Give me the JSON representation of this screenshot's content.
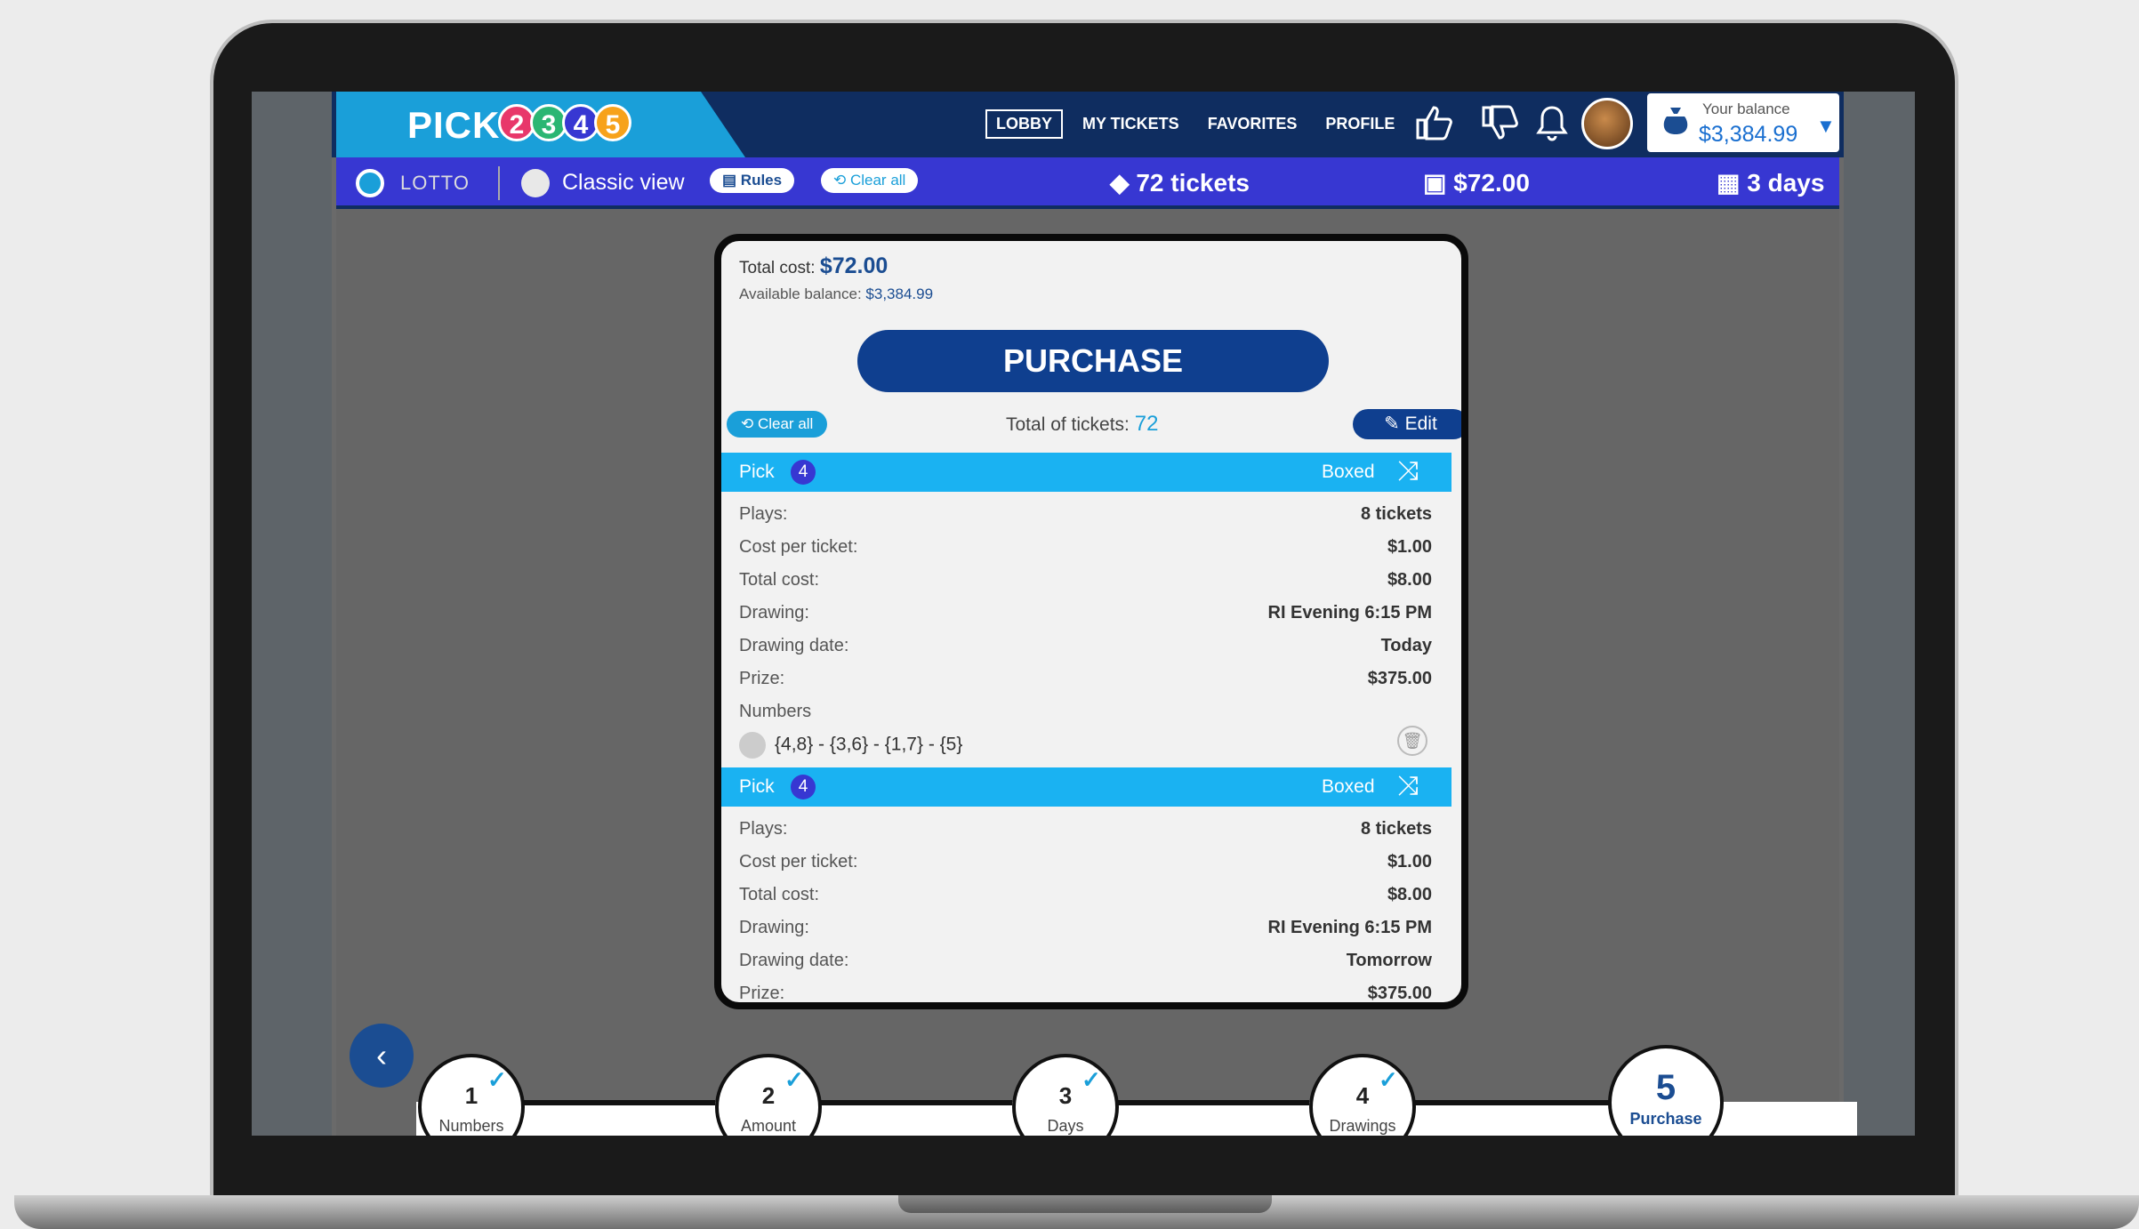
{
  "header": {
    "logo": {
      "word": "PICK",
      "balls": [
        "2",
        "3",
        "4",
        "5"
      ]
    },
    "nav": [
      {
        "label": "LOBBY",
        "active": true
      },
      {
        "label": "MY TICKETS",
        "active": false
      },
      {
        "label": "FAVORITES",
        "active": false
      },
      {
        "label": "PROFILE",
        "active": false
      }
    ],
    "icons": [
      "thumbs-up-icon",
      "thumbs-down-icon",
      "bell-icon",
      "avatar"
    ],
    "balance": {
      "label": "Your balance",
      "value": "$3,384.99"
    }
  },
  "subbar": {
    "lotto_label": "LOTTO",
    "classic_view_label": "Classic view",
    "rules_label": "Rules",
    "clear_all_label": "Clear all",
    "tickets": "72 tickets",
    "amount": "$72.00",
    "days": "3 days"
  },
  "summary": {
    "total_cost_label": "Total cost:",
    "total_cost_value": "$72.00",
    "available_label": "Available balance:",
    "available_value": "$3,384.99",
    "purchase_label": "PURCHASE",
    "clear_all_label": "Clear all",
    "total_tickets_label": "Total of tickets:",
    "total_tickets_value": "72",
    "edit_label": "Edit"
  },
  "tickets": [
    {
      "pick_label": "Pick",
      "pick_num": "4",
      "type": "Boxed",
      "rows": [
        {
          "label": "Plays:",
          "value": "8 tickets"
        },
        {
          "label": "Cost per ticket:",
          "value": "$1.00"
        },
        {
          "label": "Total cost:",
          "value": "$8.00"
        },
        {
          "label": "Drawing:",
          "value": "RI Evening 6:15 PM"
        },
        {
          "label": "Drawing date:",
          "value": "Today"
        },
        {
          "label": "Prize:",
          "value": "$375.00"
        }
      ],
      "numbers_label": "Numbers",
      "numbers": "{4,8} - {3,6} - {1,7} - {5}"
    },
    {
      "pick_label": "Pick",
      "pick_num": "4",
      "type": "Boxed",
      "rows": [
        {
          "label": "Plays:",
          "value": "8 tickets"
        },
        {
          "label": "Cost per ticket:",
          "value": "$1.00"
        },
        {
          "label": "Total cost:",
          "value": "$8.00"
        },
        {
          "label": "Drawing:",
          "value": "RI Evening 6:15 PM"
        },
        {
          "label": "Drawing date:",
          "value": "Tomorrow"
        },
        {
          "label": "Prize:",
          "value": "$375.00"
        }
      ]
    }
  ],
  "steps": [
    {
      "n": "1",
      "label": "Numbers",
      "done": true
    },
    {
      "n": "2",
      "label": "Amount",
      "done": true
    },
    {
      "n": "3",
      "label": "Days",
      "done": true
    },
    {
      "n": "4",
      "label": "Drawings",
      "done": true
    },
    {
      "n": "5",
      "label": "Purchase",
      "active": true
    }
  ],
  "colors": {
    "header": "#0f2d60",
    "subbar": "#3737d2",
    "accent": "#1a9fd9",
    "primary": "#0f3f8f"
  }
}
